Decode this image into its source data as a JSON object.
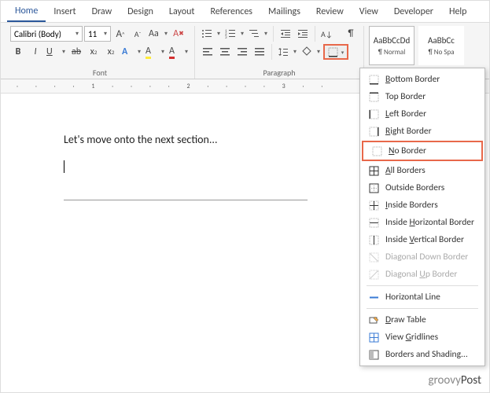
{
  "tabs": {
    "home": "Home",
    "insert": "Insert",
    "draw": "Draw",
    "design": "Design",
    "layout": "Layout",
    "references": "References",
    "mailings": "Mailings",
    "review": "Review",
    "view": "View",
    "developer": "Developer",
    "help": "Help"
  },
  "font": {
    "name": "Calibri (Body)",
    "size": "11",
    "bold": "B",
    "italic": "I",
    "underline": "U",
    "strike": "ab",
    "sub": "x",
    "sup": "x",
    "case": "Aa",
    "clear": "A",
    "grow": "A",
    "shrink": "A",
    "highlight": "A",
    "color": "A",
    "effects": "A",
    "group": "Font"
  },
  "para": {
    "group": "Paragraph"
  },
  "styles": {
    "normal_preview": "AaBbCcDd",
    "normal_name": "¶ Normal",
    "nospacing_preview": "AaBbCc",
    "nospacing_name": "¶ No Spa"
  },
  "doc": {
    "text": "Let's move onto the next section..."
  },
  "menu": {
    "bottom": "Bottom Border",
    "top": "Top Border",
    "left": "Left Border",
    "right": "Right Border",
    "none": "No Border",
    "all": "All Borders",
    "outside": "Outside Borders",
    "inside": "Inside Borders",
    "ih": "Inside Horizontal Border",
    "iv": "Inside Vertical Border",
    "dd": "Diagonal Down Border",
    "du": "Diagonal Up Border",
    "hline": "Horizontal Line",
    "draw": "Draw Table",
    "grid": "View Gridlines",
    "shading": "Borders and Shading..."
  },
  "watermark": {
    "a": "groovy",
    "b": "Post"
  }
}
